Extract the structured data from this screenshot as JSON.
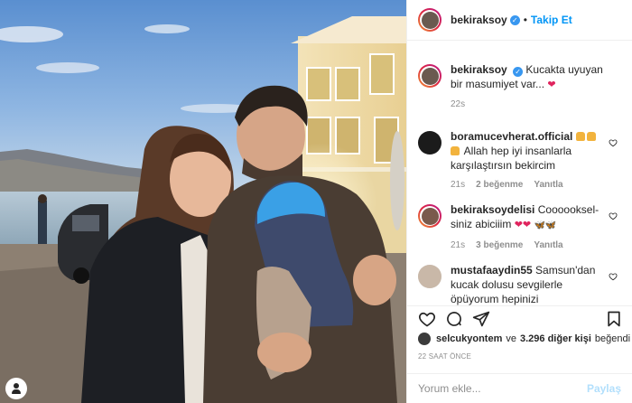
{
  "post": {
    "username": "bekiraksoy",
    "follow_label": "Takip Et",
    "caption": "Kucakta uyuyan bir masumiyet var...",
    "caption_time": "22s"
  },
  "comments": [
    {
      "username": "boramucevherat.official",
      "text": "Allah hep iyi insanlarla karşılaştırsın bekircim",
      "time": "21s",
      "likes": "2 beğenme",
      "reply": "Yanıtla"
    },
    {
      "username": "bekiraksoydelisi",
      "text": "Coooooksel­siniz abiciiim",
      "time": "21s",
      "likes": "3 beğenme",
      "reply": "Yanıtla"
    },
    {
      "username": "mustafaaydin55",
      "text": "Samsun'dan kucak dolusu sevgilerle öpüyorum hepinizi"
    }
  ],
  "likes": {
    "user": "selcukyontem",
    "connector": "ve",
    "others": "3.296 diğer kişi",
    "suffix": "beğendi"
  },
  "time_ago": "22 SAAT ÖNCE",
  "add_comment": {
    "placeholder": "Yorum ekle...",
    "post_label": "Paylaş"
  },
  "icons": [
    "verified-badge-icon",
    "heart-icon",
    "comment-icon",
    "share-icon",
    "bookmark-icon",
    "user-tag-icon"
  ],
  "colors": {
    "accent": "#0095f6",
    "heart": "#e0245e",
    "muted": "#8e8e8e",
    "post_disabled": "#b2dffc"
  }
}
